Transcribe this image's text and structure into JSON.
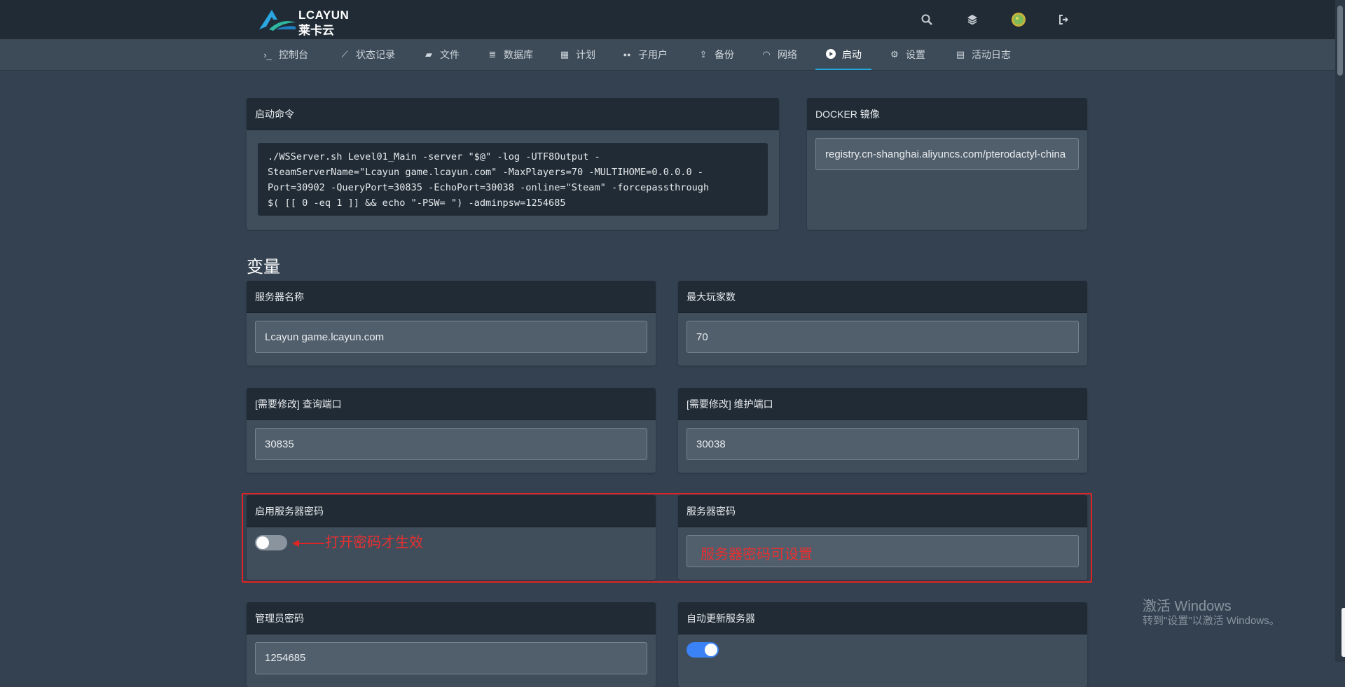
{
  "header": {
    "logo_text": "LCAYUN",
    "logo_subtext": "莱卡云",
    "icons": [
      "search-icon",
      "layers-icon",
      "avatar",
      "logout-icon"
    ]
  },
  "nav": {
    "items": [
      {
        "label": "控制台",
        "icon": "terminal-icon",
        "glyph": "›_"
      },
      {
        "label": "状态记录",
        "icon": "chart-icon",
        "glyph": "⟋"
      },
      {
        "label": "文件",
        "icon": "folder-icon",
        "glyph": "▰"
      },
      {
        "label": "数据库",
        "icon": "database-icon",
        "glyph": "≣"
      },
      {
        "label": "计划",
        "icon": "calendar-icon",
        "glyph": "▦"
      },
      {
        "label": "子用户",
        "icon": "users-icon",
        "glyph": "●●"
      },
      {
        "label": "备份",
        "icon": "upload-icon",
        "glyph": "⇪"
      },
      {
        "label": "网络",
        "icon": "network-icon",
        "glyph": "◠"
      },
      {
        "label": "启动",
        "icon": "play-circle-icon",
        "glyph": "▶",
        "active": true
      },
      {
        "label": "设置",
        "icon": "gears-icon",
        "glyph": "⚙"
      },
      {
        "label": "活动日志",
        "icon": "book-icon",
        "glyph": "▤"
      }
    ]
  },
  "startup": {
    "title": "启动命令",
    "command_lines": [
      "./WSServer.sh Level01_Main -server \"$@\" -log -UTF8Output -",
      "SteamServerName=\"Lcayun game.lcayun.com\" -MaxPlayers=70 -MULTIHOME=0.0.0.0 -",
      "Port=30902 -QueryPort=30835 -EchoPort=30038 -online=\"Steam\" -forcepassthrough",
      "$( [[ 0 -eq 1 ]] && echo \"-PSW= \") -adminpsw=1254685"
    ]
  },
  "docker": {
    "title": "DOCKER 镜像",
    "value": "registry.cn-shanghai.aliyuncs.com/pterodactyl-china"
  },
  "variables": {
    "section_title": "变量",
    "server_name": {
      "label": "服务器名称",
      "value": "Lcayun game.lcayun.com"
    },
    "max_players": {
      "label": "最大玩家数",
      "value": "70"
    },
    "query_port": {
      "label": "[需要修改] 查询端口",
      "value": "30835"
    },
    "echo_port": {
      "label": "[需要修改] 维护端口",
      "value": "30038"
    },
    "enable_password": {
      "label": "启用服务器密码",
      "enabled": false
    },
    "server_password": {
      "label": "服务器密码",
      "value": ""
    },
    "admin_password": {
      "label": "管理员密码",
      "value": "1254685"
    },
    "auto_update": {
      "label": "自动更新服务器",
      "enabled": true
    }
  },
  "annotations": {
    "toggle_note": "打开密码才生效",
    "password_note": "服务器密码可设置",
    "color": "#e02424"
  },
  "watermark": {
    "line1": "激活 Windows",
    "line2": "转到\"设置\"以激活 Windows。"
  },
  "colors": {
    "accent": "#23a9db",
    "toggle_on": "#3b82f6",
    "toggle_off": "#8a949e"
  }
}
